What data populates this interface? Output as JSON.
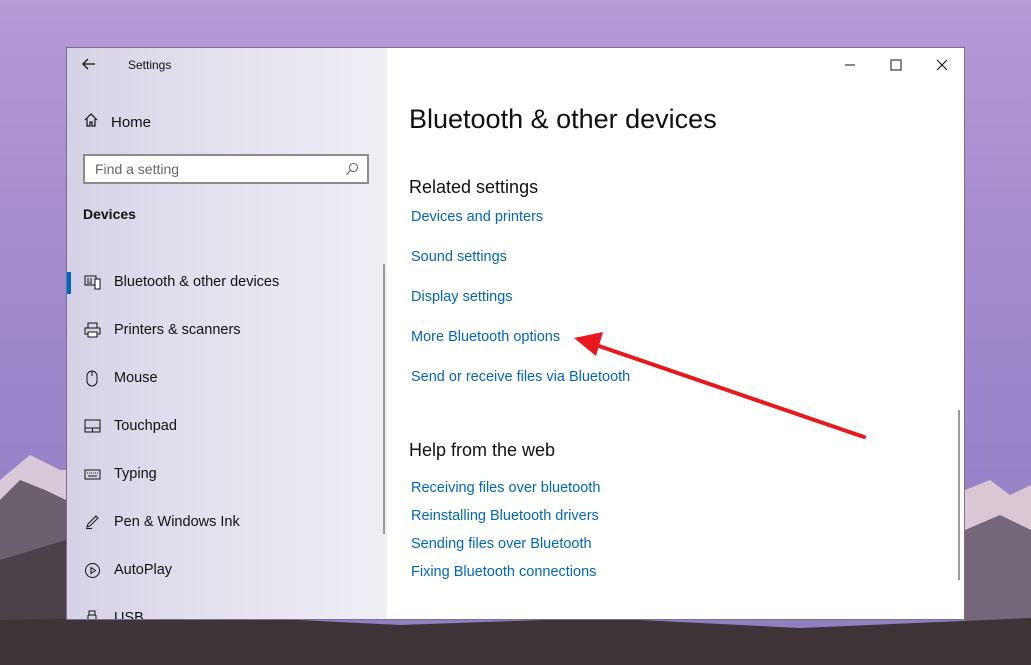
{
  "app_title": "Settings",
  "home_label": "Home",
  "search": {
    "placeholder": "Find a setting"
  },
  "section_label": "Devices",
  "nav": [
    {
      "label": "Bluetooth & other devices",
      "icon": "bluetooth-devices-icon",
      "active": true
    },
    {
      "label": "Printers & scanners",
      "icon": "printer-icon"
    },
    {
      "label": "Mouse",
      "icon": "mouse-icon"
    },
    {
      "label": "Touchpad",
      "icon": "touchpad-icon"
    },
    {
      "label": "Typing",
      "icon": "keyboard-icon"
    },
    {
      "label": "Pen & Windows Ink",
      "icon": "pen-icon"
    },
    {
      "label": "AutoPlay",
      "icon": "autoplay-icon"
    },
    {
      "label": "USB",
      "icon": "usb-icon"
    }
  ],
  "main": {
    "title": "Bluetooth & other devices",
    "related_heading": "Related settings",
    "related_links": [
      "Devices and printers",
      "Sound settings",
      "Display settings",
      "More Bluetooth options",
      "Send or receive files via Bluetooth"
    ],
    "help_heading": "Help from the web",
    "help_links": [
      "Receiving files over bluetooth",
      "Reinstalling Bluetooth drivers",
      "Sending files over Bluetooth",
      "Fixing Bluetooth connections"
    ]
  },
  "colors": {
    "accent": "#0067b8",
    "arrow": "#e8191c"
  }
}
